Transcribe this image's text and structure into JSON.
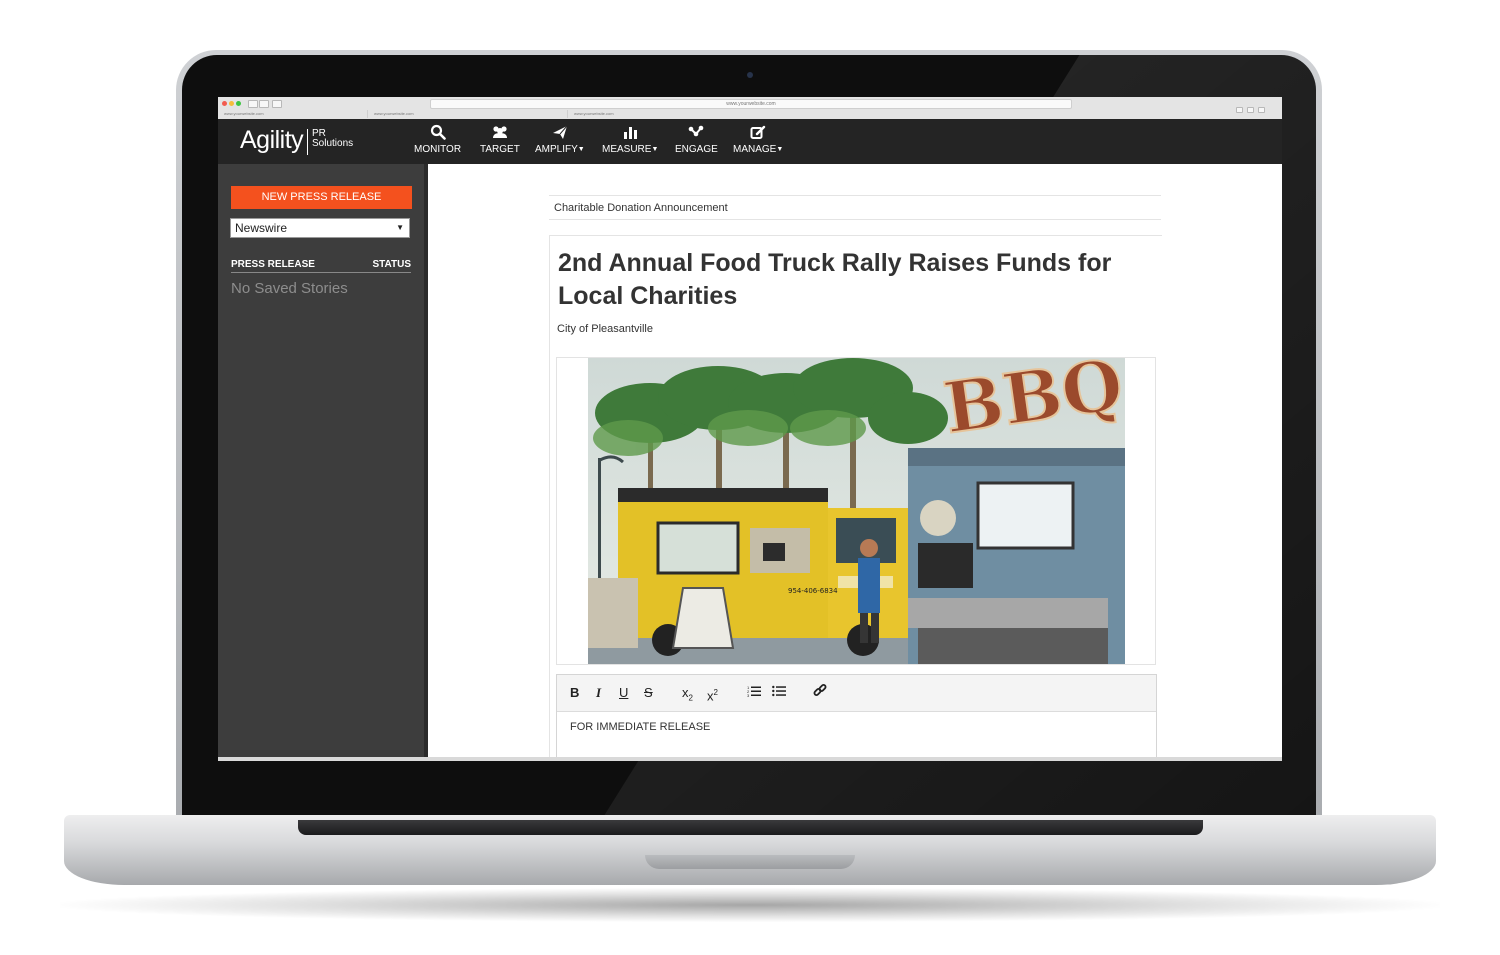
{
  "browser": {
    "url": "www.yourwebsite.com",
    "tabs": [
      "www.yourwebsite.com",
      "www.yourwebsite.com",
      "www.yourwebsite.com"
    ]
  },
  "app": {
    "logo_main": "Agility",
    "logo_sub_1": "PR",
    "logo_sub_2": "Solutions"
  },
  "nav": [
    {
      "label": "MONITOR",
      "icon": "search-icon",
      "dropdown": false
    },
    {
      "label": "TARGET",
      "icon": "users-icon",
      "dropdown": false
    },
    {
      "label": "AMPLIFY",
      "icon": "paper-plane-icon",
      "dropdown": true
    },
    {
      "label": "MEASURE",
      "icon": "bar-chart-icon",
      "dropdown": true
    },
    {
      "label": "ENGAGE",
      "icon": "network-icon",
      "dropdown": false
    },
    {
      "label": "MANAGE",
      "icon": "edit-icon",
      "dropdown": true
    }
  ],
  "sidebar": {
    "new_button": "NEW PRESS RELEASE",
    "select_value": "Newswire",
    "col_release": "PRESS RELEASE",
    "col_status": "STATUS",
    "empty_text": "No Saved Stories"
  },
  "editor": {
    "subject": "Charitable Donation Announcement",
    "headline": "2nd Annual Food Truck Rally Raises Funds for Local Charities",
    "dateline": "City of Pleasantville",
    "body_first_line": "FOR IMMEDIATE RELEASE",
    "toolbar": [
      "bold",
      "italic",
      "underline",
      "strikethrough",
      "subscript",
      "superscript",
      "ordered-list",
      "bullet-list",
      "link"
    ]
  },
  "photo": {
    "truck_phone": "954-406-6834",
    "sign_text": "BBQ"
  },
  "colors": {
    "accent": "#f4511e",
    "topbar": "#242424",
    "sidebar": "#3d3d3d"
  }
}
